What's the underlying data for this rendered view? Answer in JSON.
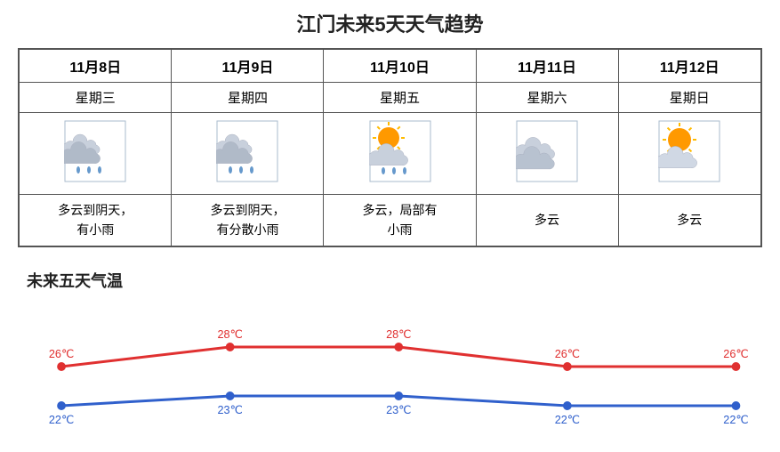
{
  "title": "江门未来5天天气趋势",
  "tempSectionTitle": "未来五天气温",
  "days": [
    {
      "date": "11月8日",
      "weekday": "星期三",
      "desc": "多云到阴天，\n有小雨",
      "iconType": "rain-cloud"
    },
    {
      "date": "11月9日",
      "weekday": "星期四",
      "desc": "多云到阴天，\n有分散小雨",
      "iconType": "rain-cloud"
    },
    {
      "date": "11月10日",
      "weekday": "星期五",
      "desc": "多云，局部有\n小雨",
      "iconType": "partly-cloudy-rain"
    },
    {
      "date": "11月11日",
      "weekday": "星期六",
      "desc": "多云",
      "iconType": "cloudy"
    },
    {
      "date": "11月12日",
      "weekday": "星期日",
      "desc": "多云",
      "iconType": "partly-sunny"
    }
  ],
  "highTemps": [
    26,
    28,
    28,
    26,
    26
  ],
  "lowTemps": [
    22,
    23,
    23,
    22,
    22
  ],
  "tempLabelsHigh": [
    "26℃",
    "28℃",
    "28℃",
    "26℃",
    "26℃"
  ],
  "tempLabelsLow": [
    "22℃",
    "23℃",
    "23℃",
    "22℃",
    "22℃"
  ]
}
